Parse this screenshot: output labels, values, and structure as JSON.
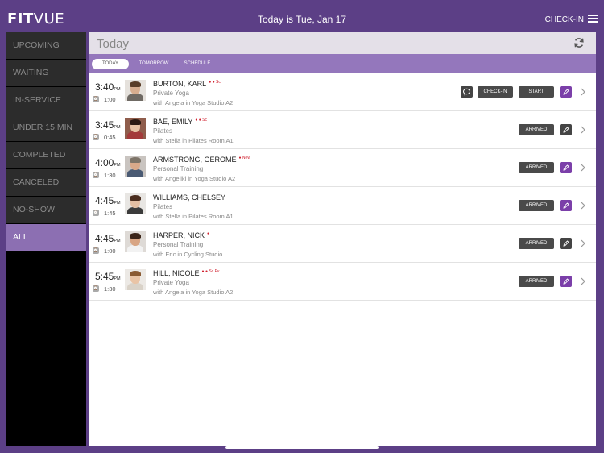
{
  "topbar": {
    "logo_a": "FIT",
    "logo_b": "VUE",
    "date_text": "Today is Tue, Jan 17",
    "checkin_label": "CHECK-IN",
    "menu_icon": "hamburger-icon"
  },
  "sidebar": {
    "items": [
      {
        "label": "UPCOMING"
      },
      {
        "label": "WAITING"
      },
      {
        "label": "IN-SERVICE"
      },
      {
        "label": "UNDER 15 MIN"
      },
      {
        "label": "COMPLETED"
      },
      {
        "label": "CANCELED"
      },
      {
        "label": "NO-SHOW"
      },
      {
        "label": "ALL"
      }
    ],
    "active_index": 7
  },
  "main": {
    "title": "Today",
    "refresh_icon": "refresh-icon",
    "tabs": [
      {
        "label": "TODAY"
      },
      {
        "label": "TOMORROW"
      },
      {
        "label": "SCHEDULE"
      }
    ],
    "active_tab": 0
  },
  "appointments": [
    {
      "time": "3:40",
      "ampm": "PM",
      "duration": "1:00",
      "name": "BURTON, KARL",
      "flags": "● ● Sc",
      "service": "Private Yoga",
      "instructor": "with Angela in Yoga Studio A2",
      "chat_icon": "chat-icon",
      "checkin_label": "CHECK-IN",
      "start_label": "START",
      "edit_style": "purple"
    },
    {
      "time": "3:45",
      "ampm": "PM",
      "duration": "0:45",
      "name": "BAE, EMILY",
      "flags": "● ● Sc",
      "service": "Pilates",
      "instructor": "with Stella in Pilates Room A1",
      "status_label": "ARRIVED",
      "edit_style": "dark"
    },
    {
      "time": "4:00",
      "ampm": "PM",
      "duration": "1:30",
      "name": "ARMSTRONG, GEROME",
      "flags": "● New",
      "service": "Personal Training",
      "instructor": "with Angeliki in Yoga Studio A2",
      "status_label": "ARRIVED",
      "edit_style": "purple"
    },
    {
      "time": "4:45",
      "ampm": "PM",
      "duration": "1:45",
      "name": "WILLIAMS, CHELSEY",
      "flags": "",
      "service": "Pilates",
      "instructor": "with Stella in Pilates Room A1",
      "status_label": "ARRIVED",
      "edit_style": "purple"
    },
    {
      "time": "4:45",
      "ampm": "PM",
      "duration": "1:00",
      "name": "HARPER, NICK",
      "flags": "●",
      "service": "Personal Training",
      "instructor": "with Eric in Cycling Studio",
      "status_label": "ARRIVED",
      "edit_style": "dark"
    },
    {
      "time": "5:45",
      "ampm": "PM",
      "duration": "1:30",
      "name": "HILL, NICOLE",
      "flags": "● ● Sc Pv",
      "service": "Private Yoga",
      "instructor": "with Angela in Yoga Studio A2",
      "status_label": "ARRIVED",
      "edit_style": "purple"
    }
  ],
  "colors": {
    "frame": "#5c3f86",
    "tabbar": "#9477bc",
    "sidebar_active": "#8c6fb2",
    "edit_purple": "#7b3fa9",
    "flag_red": "#d0202e"
  }
}
